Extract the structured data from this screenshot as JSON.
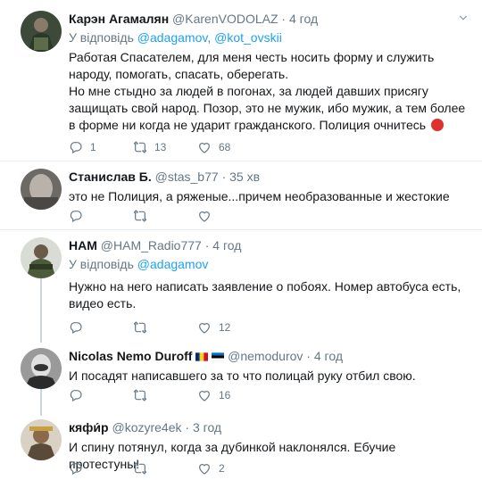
{
  "tweets": [
    {
      "name": "Карэн Агамалян",
      "handle": "@KarenVODOLAZ",
      "time": "4 год",
      "reply_prefix": "У відповідь",
      "reply_to": [
        "@adagamov",
        "@kot_ovskii"
      ],
      "text": [
        "Работая Спасателем, для меня честь носить форму и служить народу, помогать, спасать, оберегать.",
        "Но мне стыдно за людей в погонах, за людей давших присягу защищать свой народ. Позор, это не мужик, ибо мужик, а тем более в форме ни когда не ударит гражданского. Полиция очнитесь"
      ],
      "replies": "1",
      "retweets": "13",
      "likes": "68"
    },
    {
      "name": "Станислав Б.",
      "handle": "@stas_b77",
      "time": "35 хв",
      "text": [
        "это не Полиция, а ряженые...причем необразованные и жестокие"
      ],
      "replies": "",
      "retweets": "",
      "likes": ""
    },
    {
      "name": "НАМ",
      "handle": "@HAM_Radio777",
      "time": "4 год",
      "reply_prefix": "У відповідь",
      "reply_to": [
        "@adagamov"
      ],
      "text": [
        "Нужно на него написать заявление о побоях. Номер автобуса есть, видео есть."
      ],
      "replies": "",
      "retweets": "",
      "likes": "12"
    },
    {
      "name": "Nicolas Nemo Duroff",
      "handle": "@nemodurov",
      "time": "4 год",
      "text": [
        "И посадят написавшего за то что полицай руку отбил свою."
      ],
      "replies": "",
      "retweets": "",
      "likes": "16"
    },
    {
      "name": "кяфи́р",
      "handle": "@kozyre4ek",
      "time": "3 год",
      "text": [
        "И спину потянул, когда за дубинкой наклонялся. Ебучие протестуны!"
      ],
      "replies": "",
      "retweets": "",
      "likes": "2"
    }
  ],
  "colors": {
    "link": "#1da1f2",
    "muted": "#657786",
    "text": "#14171a",
    "border": "#e6ecf0"
  },
  "icons": {
    "reply": "reply-icon",
    "retweet": "retweet-icon",
    "like": "heart-icon",
    "more": "chevron-down-icon"
  }
}
